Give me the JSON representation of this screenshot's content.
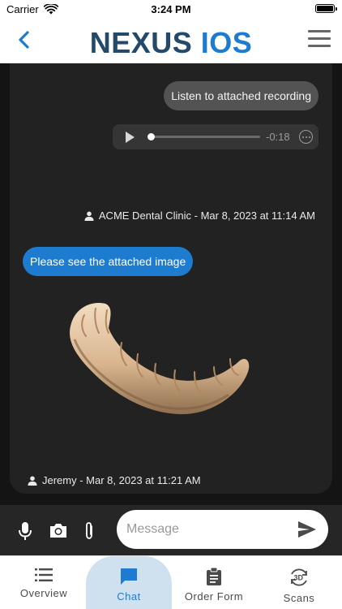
{
  "status_bar": {
    "carrier": "Carrier",
    "time": "3:24 PM"
  },
  "header": {
    "brand_part1": "NEXUS",
    "brand_part2": "IOS"
  },
  "messages": [
    {
      "type": "text",
      "side": "right",
      "text": "Listen to attached recording"
    },
    {
      "type": "audio",
      "side": "right",
      "remaining": "-0:18",
      "progress": 0.0
    },
    {
      "type": "meta",
      "author": "ACME Dental Clinic",
      "meta_text": "ACME Dental Clinic - Mar 8, 2023 at 11:14 AM"
    },
    {
      "type": "text",
      "side": "left",
      "text": "Please see the attached image"
    },
    {
      "type": "image",
      "side": "left",
      "icon": "dental-arch-image"
    },
    {
      "type": "meta",
      "author": "Jeremy",
      "meta_text": "Jeremy - Mar 8, 2023 at 11:21 AM"
    }
  ],
  "composer": {
    "placeholder": "Message"
  },
  "tabs": [
    {
      "label": "Overview",
      "icon": "list-icon",
      "active": false
    },
    {
      "label": "Chat",
      "icon": "chat-icon",
      "active": true
    },
    {
      "label": "Order Form",
      "icon": "clipboard-icon",
      "active": false
    },
    {
      "label": "Scans",
      "icon": "3d-rotate-icon",
      "active": false
    }
  ],
  "colors": {
    "brand_dark": "#254a69",
    "brand_accent": "#1d7cd0",
    "active_tab_bg": "#cfe0ef"
  }
}
